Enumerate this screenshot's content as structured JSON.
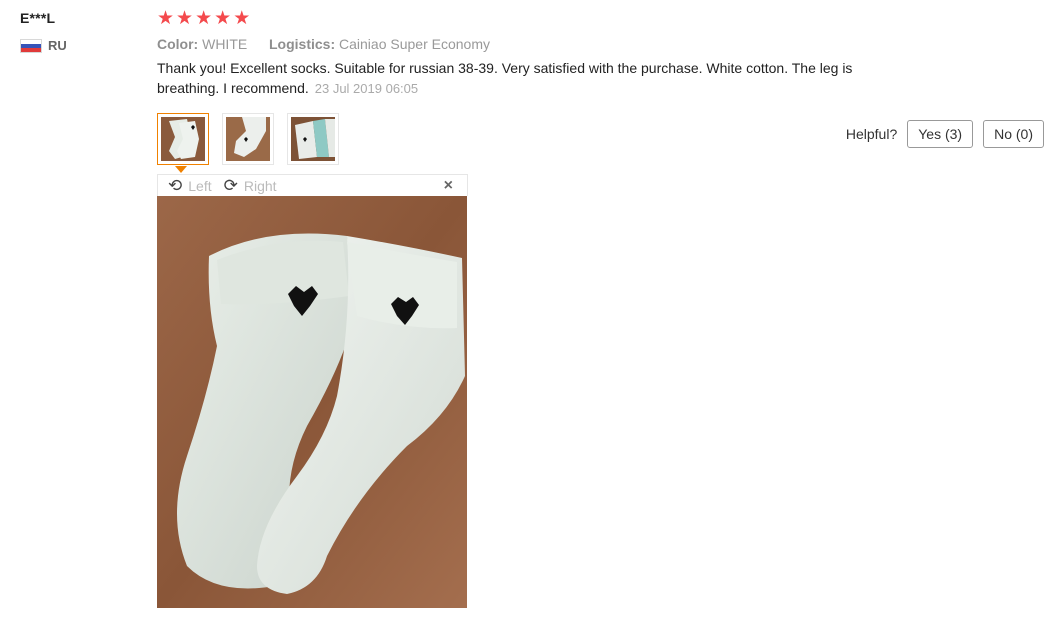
{
  "reviewer": {
    "name": "E***L",
    "country": "RU"
  },
  "review": {
    "rating": 5,
    "stars": [
      "★",
      "★",
      "★",
      "★",
      "★"
    ],
    "star_color": "#f44a4d",
    "color_label": "Color:",
    "color_value": "WHITE",
    "logistics_label": "Logistics:",
    "logistics_value": "Cainiao Super Economy",
    "text": "Thank you! Excellent socks. Suitable for russian 38-39. Very satisfied with the purchase. White cotton. The leg is breathing. I recommend.",
    "date": "23 Jul 2019 06:05"
  },
  "helpful": {
    "label": "Helpful?",
    "yes": "Yes (3)",
    "no": "No (0)"
  },
  "viewer": {
    "rotate_left": "Left",
    "rotate_right": "Right",
    "close": "×"
  },
  "accent_color": "#f08100"
}
